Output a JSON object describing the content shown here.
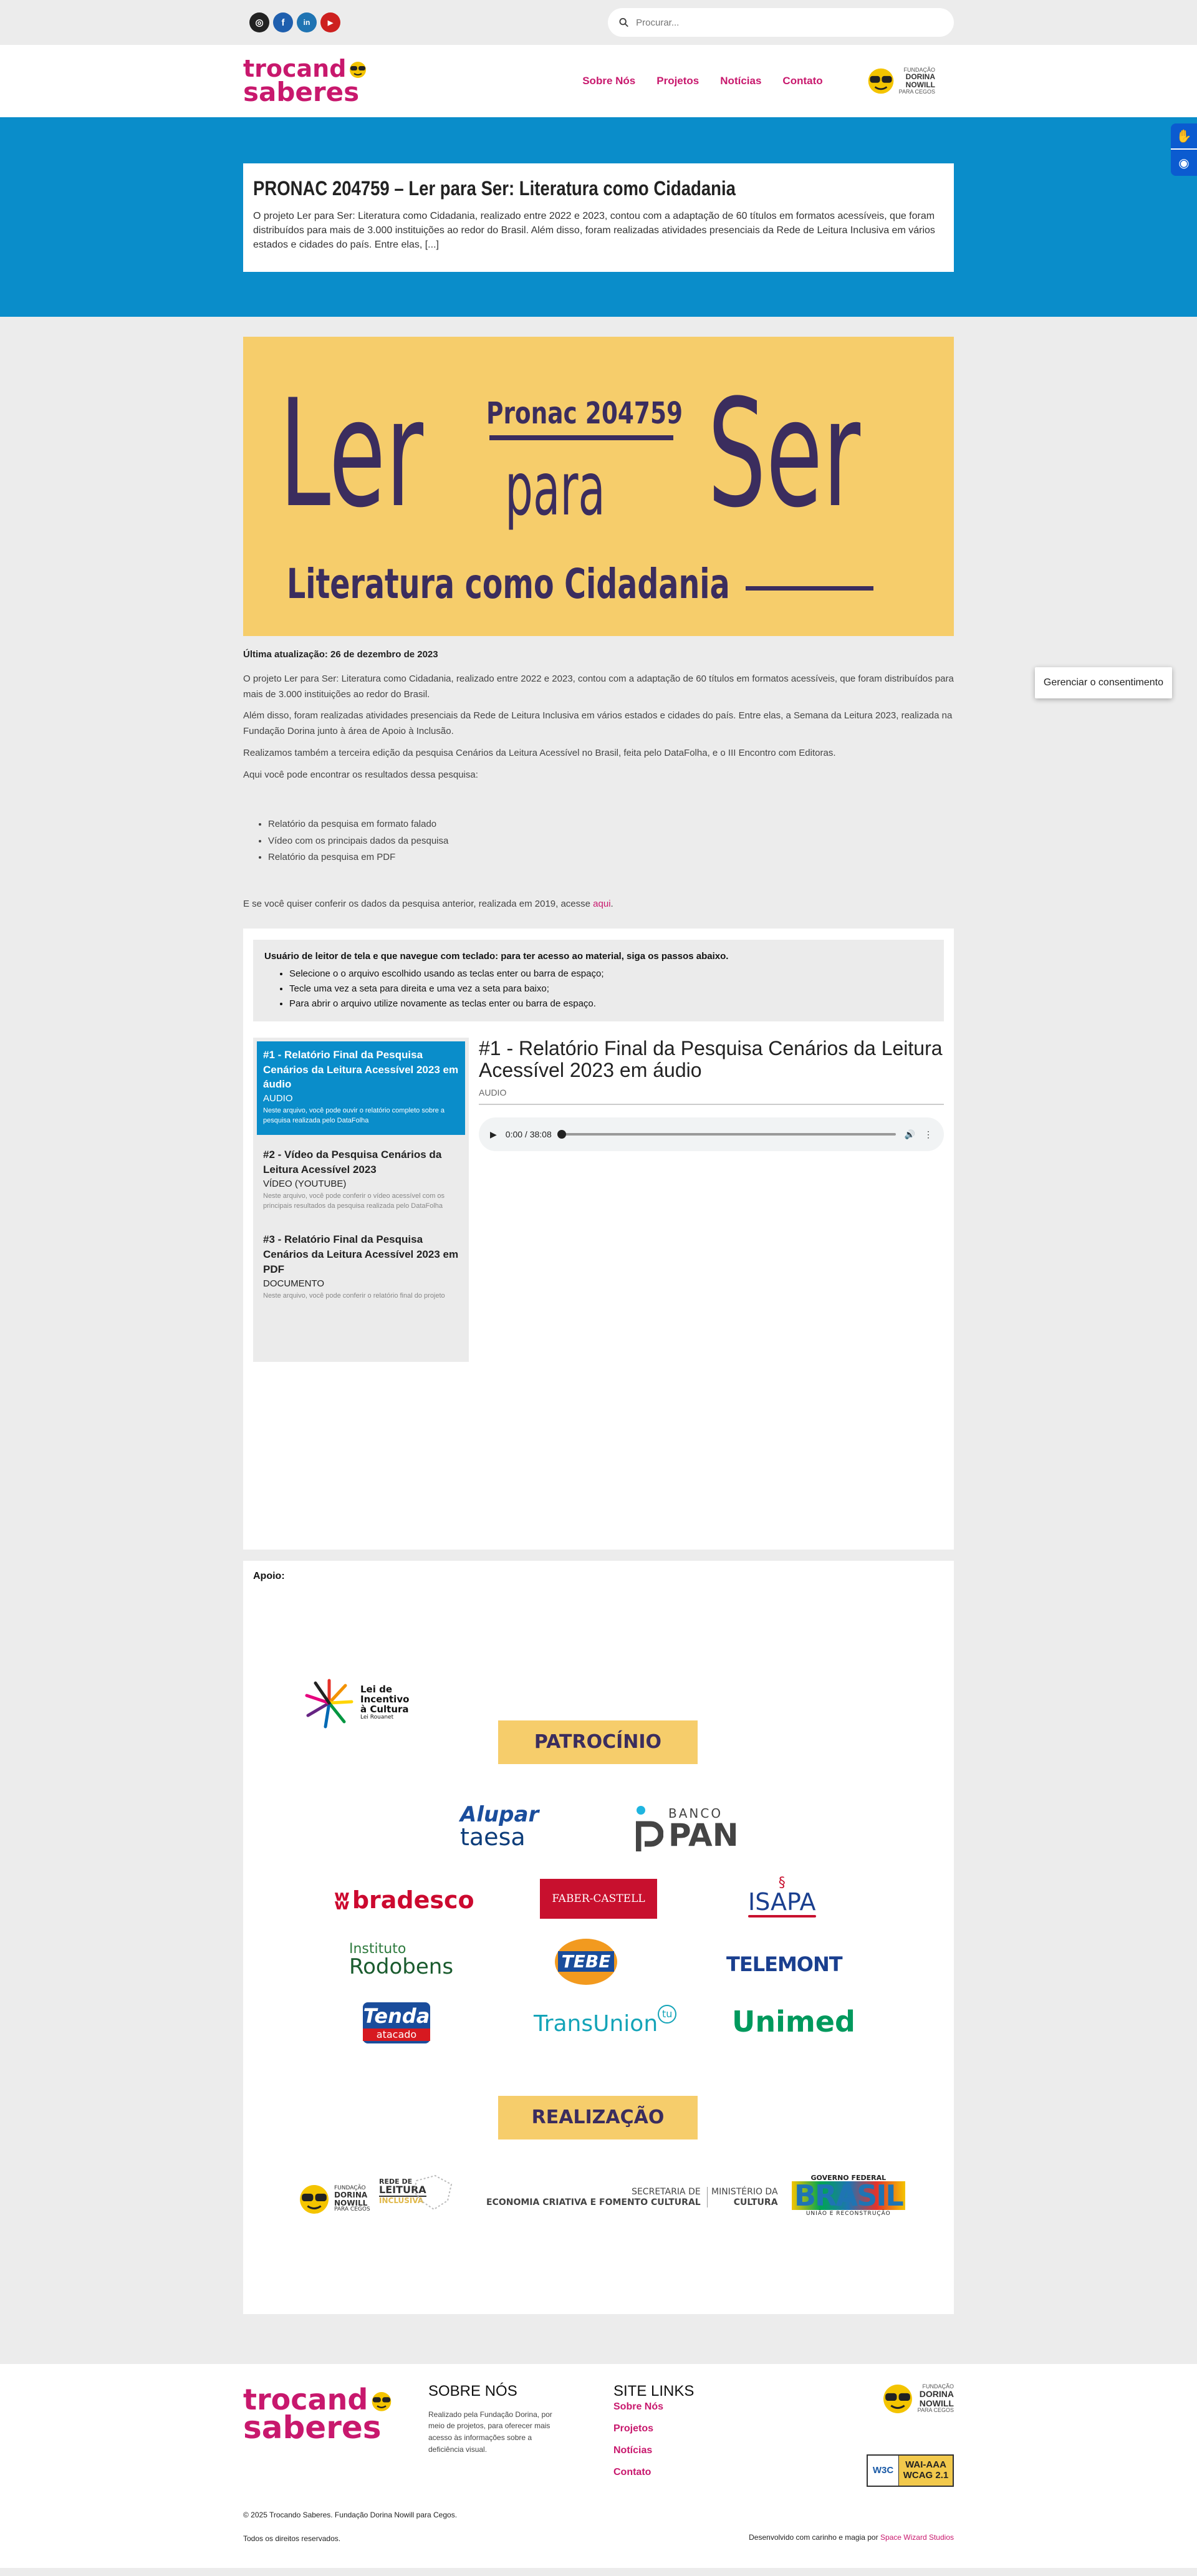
{
  "topbar": {
    "socials": [
      {
        "name": "instagram-icon",
        "glyph": "◎",
        "color": "#222222"
      },
      {
        "name": "facebook-icon",
        "glyph": "f",
        "color": "#1f5fae"
      },
      {
        "name": "linkedin-icon",
        "glyph": "in",
        "color": "#1f74b3"
      },
      {
        "name": "youtube-icon",
        "glyph": "▶",
        "color": "#cd201f"
      }
    ],
    "search_placeholder": "Procurar..."
  },
  "header": {
    "logo_line1": "trocand",
    "logo_line2": "saberes",
    "nav": [
      "Sobre Nós",
      "Projetos",
      "Notícias",
      "Contato"
    ],
    "partner_line1": "FUNDAÇÃO",
    "partner_line2": "DORINA",
    "partner_line3": "NOWILL",
    "partner_line4": "PARA CEGOS"
  },
  "featured": {
    "title": "PRONAC 204759 – Ler para Ser: Literatura como Cidadania",
    "excerpt": "O projeto Ler para Ser: Literatura como Cidadania, realizado entre 2022 e 2023, contou com a adaptação de 60 títulos em formatos acessíveis, que foram distribuídos para mais de 3.000 instituições ao redor do Brasil. Além disso, foram realizadas atividades presenciais da Rede de Leitura Inclusiva em vários estados e cidades do país. Entre elas, [...]"
  },
  "consent_label": "Gerenciar o consentimento",
  "banner": {
    "pronac": "Pronac 204759",
    "ler": "Ler",
    "para": "para",
    "ser": "Ser",
    "subtitle": "Literatura como Cidadania"
  },
  "article": {
    "updated": "Última atualização: 26 de dezembro de 2023",
    "p1": "O projeto Ler para Ser: Literatura como Cidadania, realizado entre 2022 e 2023, contou com a adaptação de 60 títulos  em formatos acessíveis, que foram distribuídos para mais de 3.000 instituições ao redor do Brasil.",
    "p2": "Além disso, foram realizadas atividades presenciais da Rede de Leitura Inclusiva em vários estados e cidades do país. Entre elas, a Semana da Leitura 2023, realizada na Fundação Dorina junto à área de Apoio à Inclusão.",
    "p3": "Realizamos também a terceira edição da pesquisa Cenários da Leitura Acessível no Brasil, feita pelo DataFolha, e o III Encontro com Editoras.",
    "p4": "Aqui você pode encontrar os resultados dessa pesquisa:",
    "list": [
      "Relatório da pesquisa em formato falado",
      "Vídeo com os principais dados da pesquisa",
      "Relatório da pesquisa em PDF"
    ],
    "p5": "E se você quiser conferir os dados da pesquisa anterior, realizada em 2019, acesse",
    "p5_link": "aqui",
    "p5_end": "."
  },
  "instructions": {
    "title": "Usuário de leitor de tela e que navegue com teclado: para ter acesso ao material, siga os passos abaixo.",
    "steps": [
      "Selecione o o arquivo escolhido usando as teclas enter ou barra de espaço;",
      "Tecle uma vez a seta para direita e uma vez a seta para baixo;",
      "Para abrir o arquivo utilize novamente as teclas enter ou barra de espaço."
    ]
  },
  "playlist": [
    {
      "title": "#1 - Relatório Final da Pesquisa Cenários da Leitura Acessível 2023 em áudio",
      "type": "AUDIO",
      "desc": "Neste arquivo, você pode ouvir o relatório completo sobre a pesquisa realizada pelo DataFolha"
    },
    {
      "title": "#2 - Vídeo da Pesquisa Cenários da Leitura Acessível 2023",
      "type": "VÍDEO (YOUTUBE)",
      "desc": "Neste arquivo, você pode conferir o vídeo acessível com os principais resultados da pesquisa realizada pelo DataFolha"
    },
    {
      "title": "#3 - Relatório Final da Pesquisa Cenários da Leitura Acessível 2023 em PDF",
      "type": "DOCUMENTO",
      "desc": "Neste arquivo, você pode conferir o relatório final do projeto"
    }
  ],
  "viewer": {
    "title": "#1 - Relatório Final da Pesquisa Cenários da Leitura Acessível 2023 em áudio",
    "type": "AUDIO",
    "time": "0:00 / 38:08"
  },
  "apoio": {
    "label": "Apoio:",
    "rouanet_line1": "Lei de",
    "rouanet_line2": "Incentivo",
    "rouanet_line3": "à Cultura",
    "rouanet_line4": "Lei Rouanet",
    "patrocinio": "PATROCÍNIO",
    "alupar_1": "Alupar",
    "alupar_2": "taesa",
    "banco": "BANCO",
    "pan": "PAN",
    "bradesco": "bradesco",
    "faber": "FABER-CASTELL",
    "isapa": "ISAPA",
    "instituto": "Instituto",
    "rodobens": "Rodobens",
    "tebe": "TEBE",
    "telemont": "TELEMONT",
    "tenda_1": "Tenda",
    "tenda_2": "atacado",
    "transunion": "TransUnion",
    "unimed": "Unimed",
    "realizacao": "REALIZAÇÃO",
    "rede_1": "REDE DE",
    "rede_2": "LEITURA",
    "rede_3": "INCLUSIVA",
    "sec_1": "SECRETARIA DE",
    "sec_2": "ECONOMIA CRIATIVA E FOMENTO CULTURAL",
    "min_1": "MINISTÉRIO DA",
    "min_2": "CULTURA",
    "gov_1": "GOVERNO FEDERAL",
    "gov_2": "BRASIL",
    "gov_3": "UNIÃO E RECONSTRUÇÃO"
  },
  "footer": {
    "about_title": "SOBRE NÓS",
    "about_text": "Realizado pela Fundação Dorina, por meio de projetos, para oferecer mais acesso às informações sobre a deficiência visual.",
    "links_title": "SITE LINKS",
    "links": [
      "Sobre Nós",
      "Projetos",
      "Notícias",
      "Contato"
    ],
    "w3c": "W3C",
    "wai_1": "WAI-AAA",
    "wai_2": "WCAG 2.1",
    "copyright": "© 2025 Trocando Saberes. Fundação Dorina Nowill para Cegos.",
    "rights": "Todos os direitos reservados.",
    "dev_text": "Desenvolvido com carinho e magia por",
    "dev_name": "Space Wizard Studios"
  },
  "colors": {
    "brand": "#c8186d",
    "blue": "#0a8dca",
    "yellow": "#f6cd6b",
    "purple": "#3b2d5e"
  }
}
